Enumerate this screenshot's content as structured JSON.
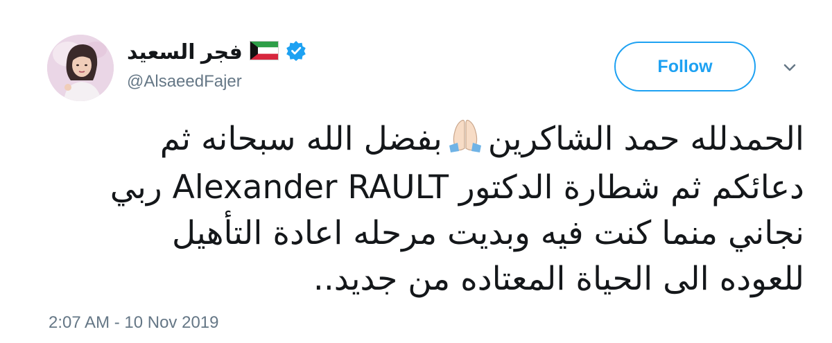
{
  "author": {
    "name": "فجر السعيد",
    "handle": "@AlsaeedFajer",
    "verified": true,
    "flag": "kuwait-flag"
  },
  "follow_label": "Follow",
  "tweet": {
    "lines": [
      "الحمدلله حمد الشاكرين",
      "بفضل الله سبحانه ثم",
      "دعائكم ثم شطارة الدكتور Alexander RAULT ربي",
      "نجاني منما كنت فيه وبديت مرحله اعادة التأهيل",
      "للعوده الى الحياة المعتاده من جديد.."
    ],
    "emoji": "folded-hands-emoji"
  },
  "timestamp": "2:07 AM - 10 Nov 2019",
  "colors": {
    "accent": "#1da1f2",
    "text": "#14171a",
    "secondary": "#657786"
  }
}
